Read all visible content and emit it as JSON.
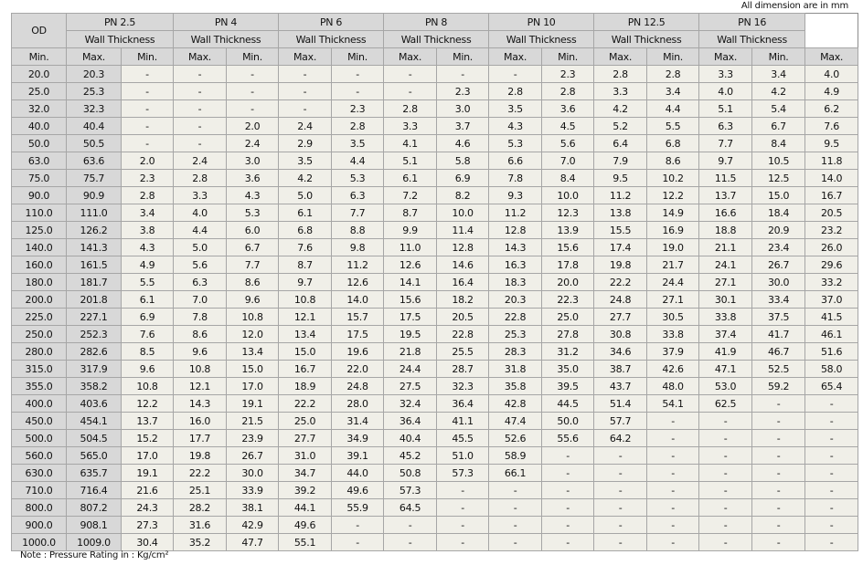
{
  "unit_note": "All dimension are in mm",
  "footer_note": "Note : Pressure Rating in : Kg/cm²",
  "header": {
    "od_label": "OD",
    "sub_label": "Wall Thickness",
    "min_label": "Min.",
    "max_label": "Max.",
    "pn_groups": [
      "PN 2.5",
      "PN 4",
      "PN 6",
      "PN 8",
      "PN 10",
      "PN 12.5",
      "PN 16"
    ]
  },
  "rows": [
    {
      "od": [
        "20.0",
        "20.3"
      ],
      "vals": [
        "-",
        "-",
        "-",
        "-",
        "-",
        "-",
        "-",
        "-",
        "2.3",
        "2.8",
        "2.8",
        "3.3",
        "3.4",
        "4.0"
      ]
    },
    {
      "od": [
        "25.0",
        "25.3"
      ],
      "vals": [
        "-",
        "-",
        "-",
        "-",
        "-",
        "-",
        "2.3",
        "2.8",
        "2.8",
        "3.3",
        "3.4",
        "4.0",
        "4.2",
        "4.9"
      ]
    },
    {
      "od": [
        "32.0",
        "32.3"
      ],
      "vals": [
        "-",
        "-",
        "-",
        "-",
        "2.3",
        "2.8",
        "3.0",
        "3.5",
        "3.6",
        "4.2",
        "4.4",
        "5.1",
        "5.4",
        "6.2"
      ]
    },
    {
      "od": [
        "40.0",
        "40.4"
      ],
      "vals": [
        "-",
        "-",
        "2.0",
        "2.4",
        "2.8",
        "3.3",
        "3.7",
        "4.3",
        "4.5",
        "5.2",
        "5.5",
        "6.3",
        "6.7",
        "7.6"
      ]
    },
    {
      "od": [
        "50.0",
        "50.5"
      ],
      "vals": [
        "-",
        "-",
        "2.4",
        "2.9",
        "3.5",
        "4.1",
        "4.6",
        "5.3",
        "5.6",
        "6.4",
        "6.8",
        "7.7",
        "8.4",
        "9.5"
      ]
    },
    {
      "od": [
        "63.0",
        "63.6"
      ],
      "vals": [
        "2.0",
        "2.4",
        "3.0",
        "3.5",
        "4.4",
        "5.1",
        "5.8",
        "6.6",
        "7.0",
        "7.9",
        "8.6",
        "9.7",
        "10.5",
        "11.8"
      ]
    },
    {
      "od": [
        "75.0",
        "75.7"
      ],
      "vals": [
        "2.3",
        "2.8",
        "3.6",
        "4.2",
        "5.3",
        "6.1",
        "6.9",
        "7.8",
        "8.4",
        "9.5",
        "10.2",
        "11.5",
        "12.5",
        "14.0"
      ]
    },
    {
      "od": [
        "90.0",
        "90.9"
      ],
      "vals": [
        "2.8",
        "3.3",
        "4.3",
        "5.0",
        "6.3",
        "7.2",
        "8.2",
        "9.3",
        "10.0",
        "11.2",
        "12.2",
        "13.7",
        "15.0",
        "16.7"
      ]
    },
    {
      "od": [
        "110.0",
        "111.0"
      ],
      "vals": [
        "3.4",
        "4.0",
        "5.3",
        "6.1",
        "7.7",
        "8.7",
        "10.0",
        "11.2",
        "12.3",
        "13.8",
        "14.9",
        "16.6",
        "18.4",
        "20.5"
      ]
    },
    {
      "od": [
        "125.0",
        "126.2"
      ],
      "vals": [
        "3.8",
        "4.4",
        "6.0",
        "6.8",
        "8.8",
        "9.9",
        "11.4",
        "12.8",
        "13.9",
        "15.5",
        "16.9",
        "18.8",
        "20.9",
        "23.2"
      ]
    },
    {
      "od": [
        "140.0",
        "141.3"
      ],
      "vals": [
        "4.3",
        "5.0",
        "6.7",
        "7.6",
        "9.8",
        "11.0",
        "12.8",
        "14.3",
        "15.6",
        "17.4",
        "19.0",
        "21.1",
        "23.4",
        "26.0"
      ]
    },
    {
      "od": [
        "160.0",
        "161.5"
      ],
      "vals": [
        "4.9",
        "5.6",
        "7.7",
        "8.7",
        "11.2",
        "12.6",
        "14.6",
        "16.3",
        "17.8",
        "19.8",
        "21.7",
        "24.1",
        "26.7",
        "29.6"
      ]
    },
    {
      "od": [
        "180.0",
        "181.7"
      ],
      "vals": [
        "5.5",
        "6.3",
        "8.6",
        "9.7",
        "12.6",
        "14.1",
        "16.4",
        "18.3",
        "20.0",
        "22.2",
        "24.4",
        "27.1",
        "30.0",
        "33.2"
      ]
    },
    {
      "od": [
        "200.0",
        "201.8"
      ],
      "vals": [
        "6.1",
        "7.0",
        "9.6",
        "10.8",
        "14.0",
        "15.6",
        "18.2",
        "20.3",
        "22.3",
        "24.8",
        "27.1",
        "30.1",
        "33.4",
        "37.0"
      ]
    },
    {
      "od": [
        "225.0",
        "227.1"
      ],
      "vals": [
        "6.9",
        "7.8",
        "10.8",
        "12.1",
        "15.7",
        "17.5",
        "20.5",
        "22.8",
        "25.0",
        "27.7",
        "30.5",
        "33.8",
        "37.5",
        "41.5"
      ]
    },
    {
      "od": [
        "250.0",
        "252.3"
      ],
      "vals": [
        "7.6",
        "8.6",
        "12.0",
        "13.4",
        "17.5",
        "19.5",
        "22.8",
        "25.3",
        "27.8",
        "30.8",
        "33.8",
        "37.4",
        "41.7",
        "46.1"
      ]
    },
    {
      "od": [
        "280.0",
        "282.6"
      ],
      "vals": [
        "8.5",
        "9.6",
        "13.4",
        "15.0",
        "19.6",
        "21.8",
        "25.5",
        "28.3",
        "31.2",
        "34.6",
        "37.9",
        "41.9",
        "46.7",
        "51.6"
      ]
    },
    {
      "od": [
        "315.0",
        "317.9"
      ],
      "vals": [
        "9.6",
        "10.8",
        "15.0",
        "16.7",
        "22.0",
        "24.4",
        "28.7",
        "31.8",
        "35.0",
        "38.7",
        "42.6",
        "47.1",
        "52.5",
        "58.0"
      ]
    },
    {
      "od": [
        "355.0",
        "358.2"
      ],
      "vals": [
        "10.8",
        "12.1",
        "17.0",
        "18.9",
        "24.8",
        "27.5",
        "32.3",
        "35.8",
        "39.5",
        "43.7",
        "48.0",
        "53.0",
        "59.2",
        "65.4"
      ]
    },
    {
      "od": [
        "400.0",
        "403.6"
      ],
      "vals": [
        "12.2",
        "14.3",
        "19.1",
        "22.2",
        "28.0",
        "32.4",
        "36.4",
        "42.8",
        "44.5",
        "51.4",
        "54.1",
        "62.5",
        "-",
        "-"
      ]
    },
    {
      "od": [
        "450.0",
        "454.1"
      ],
      "vals": [
        "13.7",
        "16.0",
        "21.5",
        "25.0",
        "31.4",
        "36.4",
        "41.1",
        "47.4",
        "50.0",
        "57.7",
        "-",
        "-",
        "-",
        "-"
      ]
    },
    {
      "od": [
        "500.0",
        "504.5"
      ],
      "vals": [
        "15.2",
        "17.7",
        "23.9",
        "27.7",
        "34.9",
        "40.4",
        "45.5",
        "52.6",
        "55.6",
        "64.2",
        "-",
        "-",
        "-",
        "-"
      ]
    },
    {
      "od": [
        "560.0",
        "565.0"
      ],
      "vals": [
        "17.0",
        "19.8",
        "26.7",
        "31.0",
        "39.1",
        "45.2",
        "51.0",
        "58.9",
        "-",
        "-",
        "-",
        "-",
        "-",
        "-"
      ]
    },
    {
      "od": [
        "630.0",
        "635.7"
      ],
      "vals": [
        "19.1",
        "22.2",
        "30.0",
        "34.7",
        "44.0",
        "50.8",
        "57.3",
        "66.1",
        "-",
        "-",
        "-",
        "-",
        "-",
        "-"
      ]
    },
    {
      "od": [
        "710.0",
        "716.4"
      ],
      "vals": [
        "21.6",
        "25.1",
        "33.9",
        "39.2",
        "49.6",
        "57.3",
        "-",
        "-",
        "-",
        "-",
        "-",
        "-",
        "-",
        "-"
      ]
    },
    {
      "od": [
        "800.0",
        "807.2"
      ],
      "vals": [
        "24.3",
        "28.2",
        "38.1",
        "44.1",
        "55.9",
        "64.5",
        "-",
        "-",
        "-",
        "-",
        "-",
        "-",
        "-",
        "-"
      ]
    },
    {
      "od": [
        "900.0",
        "908.1"
      ],
      "vals": [
        "27.3",
        "31.6",
        "42.9",
        "49.6",
        "-",
        "-",
        "-",
        "-",
        "-",
        "-",
        "-",
        "-",
        "-",
        "-"
      ]
    },
    {
      "od": [
        "1000.0",
        "1009.0"
      ],
      "vals": [
        "30.4",
        "35.2",
        "47.7",
        "55.1",
        "-",
        "-",
        "-",
        "-",
        "-",
        "-",
        "-",
        "-",
        "-",
        "-"
      ]
    }
  ]
}
